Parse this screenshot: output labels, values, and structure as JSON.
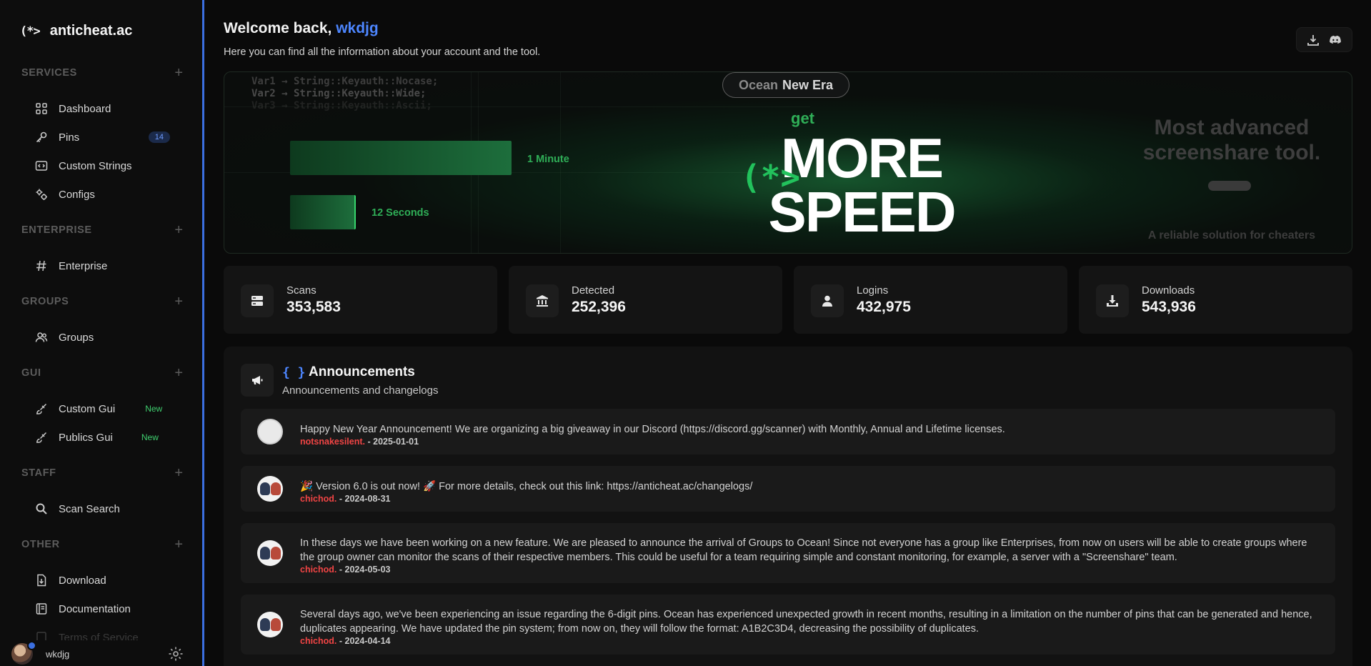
{
  "brand": {
    "logo": "(*>",
    "name": "anticheat.ac"
  },
  "sidebar": {
    "sections": [
      {
        "title": "SERVICES",
        "items": [
          {
            "label": "Dashboard",
            "icon": "grid-icon"
          },
          {
            "label": "Pins",
            "icon": "key-icon",
            "badge": "14"
          },
          {
            "label": "Custom Strings",
            "icon": "code-box-icon"
          },
          {
            "label": "Configs",
            "icon": "gears-icon"
          }
        ]
      },
      {
        "title": "ENTERPRISE",
        "items": [
          {
            "label": "Enterprise",
            "icon": "hash-icon"
          }
        ]
      },
      {
        "title": "GROUPS",
        "items": [
          {
            "label": "Groups",
            "icon": "users-icon"
          }
        ]
      },
      {
        "title": "GUI",
        "items": [
          {
            "label": "Custom Gui",
            "icon": "brush-icon",
            "badge": "New"
          },
          {
            "label": "Publics Gui",
            "icon": "brush-icon",
            "badge": "New"
          }
        ]
      },
      {
        "title": "STAFF",
        "items": [
          {
            "label": "Scan Search",
            "icon": "search-icon"
          }
        ]
      },
      {
        "title": "OTHER",
        "items": [
          {
            "label": "Download",
            "icon": "file-download-icon"
          },
          {
            "label": "Documentation",
            "icon": "book-icon"
          },
          {
            "label": "Terms of Service",
            "icon": "doc-icon"
          }
        ]
      }
    ],
    "user": {
      "name": "wkdjg"
    }
  },
  "header": {
    "welcome_prefix": "Welcome back,",
    "username": "wkdjg",
    "subtitle": "Here you can find all the information about your account and the tool."
  },
  "banner": {
    "code_lines": [
      "Var1 → String::Keyauth::Nocase;",
      "Var2 → String::Keyauth::Wide;",
      "Var3 → String::Keyauth::Ascii;"
    ],
    "bar_long_label": "1 Minute",
    "bar_short_label": "12 Seconds",
    "pill_part1": "Ocean",
    "pill_part2": "New Era",
    "get": "get",
    "more": "MORE",
    "speed": "SPEED",
    "logo_mark": "(*>",
    "promo_title": "Most advanced screenshare tool.",
    "promo_footer": "A reliable solution for cheaters"
  },
  "stats": [
    {
      "label": "Scans",
      "value": "353,583",
      "icon": "server-icon"
    },
    {
      "label": "Detected",
      "value": "252,396",
      "icon": "bank-icon"
    },
    {
      "label": "Logins",
      "value": "432,975",
      "icon": "user-icon"
    },
    {
      "label": "Downloads",
      "value": "543,936",
      "icon": "download-icon"
    }
  ],
  "announcements": {
    "braces": "{ }",
    "title": "Announcements",
    "subtitle": "Announcements and changelogs",
    "items": [
      {
        "text": "Happy New Year Announcement! We are organizing a big giveaway in our Discord (https://discord.gg/scanner) with Monthly, Annual and Lifetime licenses.",
        "author": "notsnakesilent.",
        "date": "- 2025-01-01"
      },
      {
        "text": "🎉 Version 6.0 is out now! 🚀 For more details, check out this link: https://anticheat.ac/changelogs/",
        "author": "chichod.",
        "date": "- 2024-08-31"
      },
      {
        "text": "In these days we have been working on a new feature. We are pleased to announce the arrival of Groups to Ocean! Since not everyone has a group like Enterprises, from now on users will be able to create groups where the group owner can monitor the scans of their respective members. This could be useful for a team requiring simple and constant monitoring, for example, a server with a \"Screenshare\" team.",
        "author": "chichod.",
        "date": "- 2024-05-03"
      },
      {
        "text": "Several days ago, we've been experiencing an issue regarding the 6-digit pins. Ocean has experienced unexpected growth in recent months, resulting in a limitation on the number of pins that can be generated and hence, duplicates appearing. We have updated the pin system; from now on, they will follow the format: A1B2C3D4, decreasing the possibility of duplicates.",
        "author": "chichod.",
        "date": "- 2024-04-14"
      }
    ]
  },
  "colors": {
    "accent": "#4d86ff",
    "green": "#2fae57",
    "author_red": "#f04444",
    "new_badge": "#3fcf6f"
  }
}
